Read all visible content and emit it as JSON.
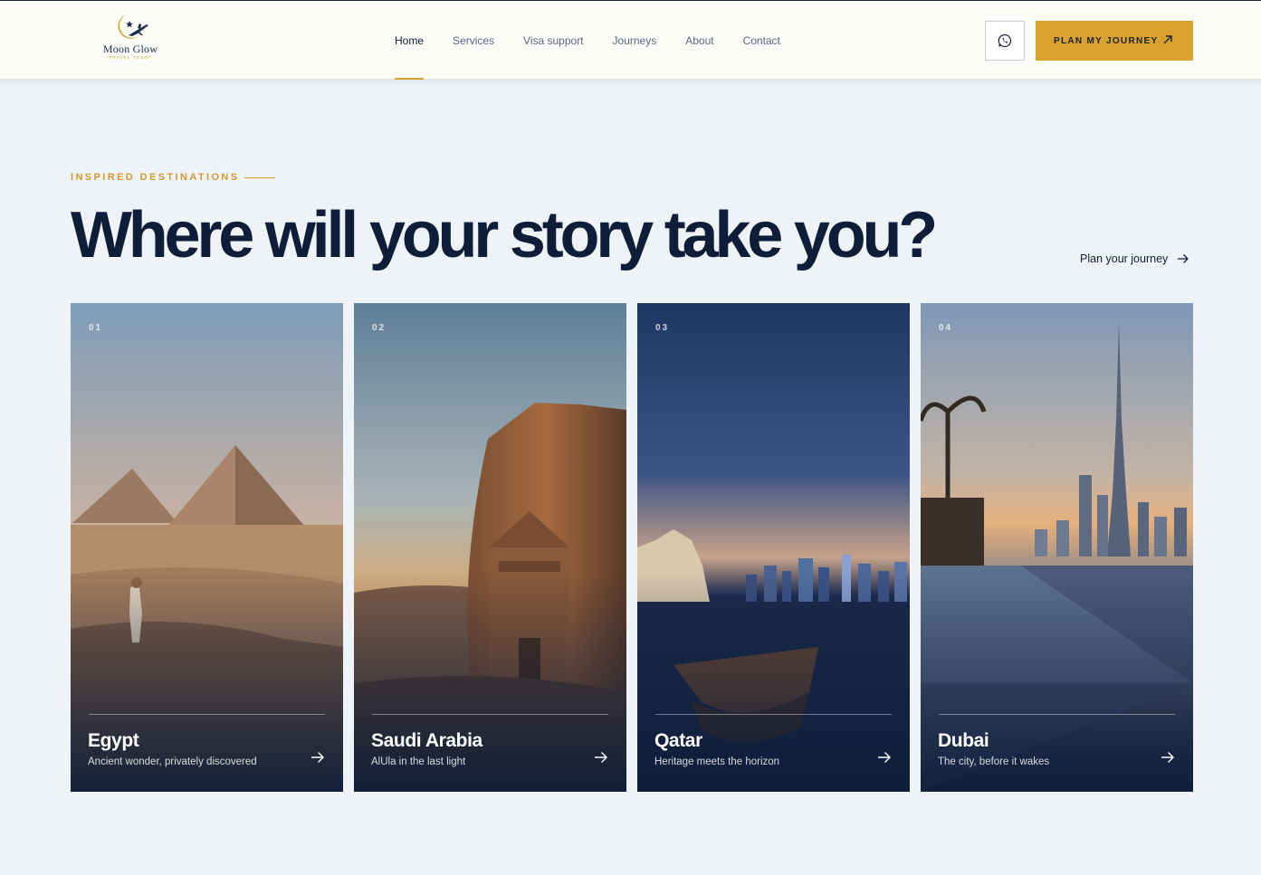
{
  "brand": {
    "name": "Moon Glow",
    "tagline": "TRAVEL AGENT",
    "accent": "#d9a22e",
    "navy": "#0e1d38"
  },
  "nav": {
    "items": [
      {
        "label": "Home",
        "active": true
      },
      {
        "label": "Services"
      },
      {
        "label": "Visa support"
      },
      {
        "label": "Journeys"
      },
      {
        "label": "About"
      },
      {
        "label": "Contact"
      }
    ],
    "whatsapp_icon": "whatsapp-icon",
    "cta_label": "PLAN MY JOURNEY"
  },
  "hero": {
    "eyebrow": "INSPIRED DESTINATIONS",
    "headline": "Where will your story take you?",
    "link_label": "Plan your journey"
  },
  "destinations": [
    {
      "number": "01",
      "title": "Egypt",
      "subtitle": "Ancient wonder, privately discovered"
    },
    {
      "number": "02",
      "title": "Saudi Arabia",
      "subtitle": "AlUla in the last light"
    },
    {
      "number": "03",
      "title": "Qatar",
      "subtitle": "Heritage meets the horizon"
    },
    {
      "number": "04",
      "title": "Dubai",
      "subtitle": "The city, before it wakes"
    }
  ]
}
